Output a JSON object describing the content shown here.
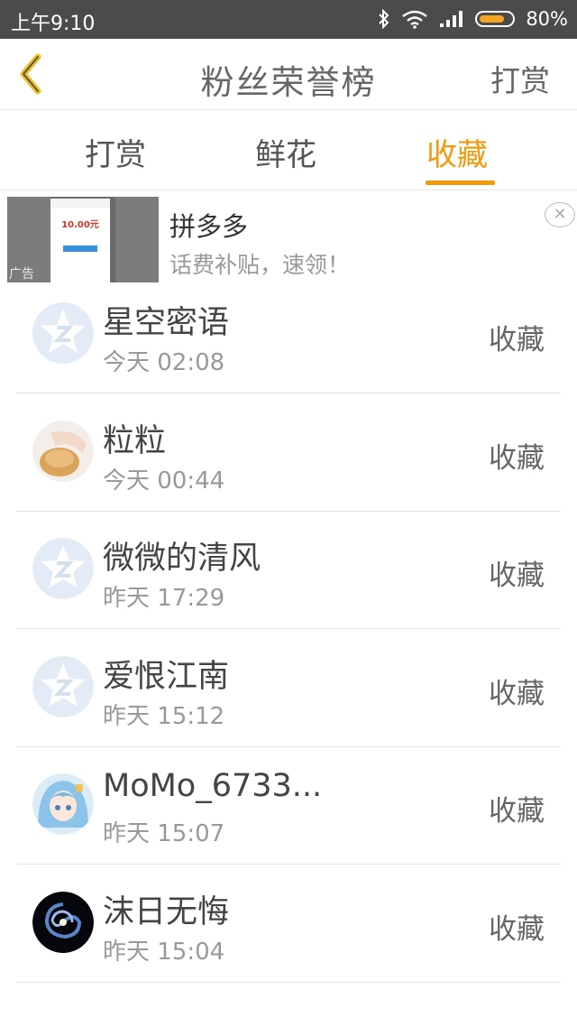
{
  "status_bar": {
    "time": "上午9:10",
    "battery": "80%",
    "battery_level": 0.8
  },
  "header": {
    "title": "粉丝荣誉榜",
    "right_action": "打赏",
    "back_icon": "chevron-left-icon"
  },
  "tabs": [
    {
      "label": "打赏",
      "active": false
    },
    {
      "label": "鲜花",
      "active": false
    },
    {
      "label": "收藏",
      "active": true
    }
  ],
  "accent_color": "#f19a0c",
  "ad": {
    "name": "拼多多",
    "subtitle": "话费补贴，速领！",
    "badge": "广告",
    "image_amount": "10.00元"
  },
  "fans": [
    {
      "name": "星空密语",
      "time": "今天 02:08",
      "action": "收藏",
      "avatar": "default-star-avatar"
    },
    {
      "name": "粒粒",
      "time": "今天 00:44",
      "action": "收藏",
      "avatar": "food-photo-avatar"
    },
    {
      "name": "微微的清风",
      "time": "昨天 17:29",
      "action": "收藏",
      "avatar": "default-star-avatar"
    },
    {
      "name": "爱恨江南",
      "time": "昨天 15:12",
      "action": "收藏",
      "avatar": "default-star-avatar"
    },
    {
      "name": "MoMo_6733...",
      "time": "昨天 15:07",
      "action": "收藏",
      "avatar": "anime-girl-avatar"
    },
    {
      "name": "沫日无悔",
      "time": "昨天 15:04",
      "action": "收藏",
      "avatar": "galaxy-avatar"
    }
  ]
}
